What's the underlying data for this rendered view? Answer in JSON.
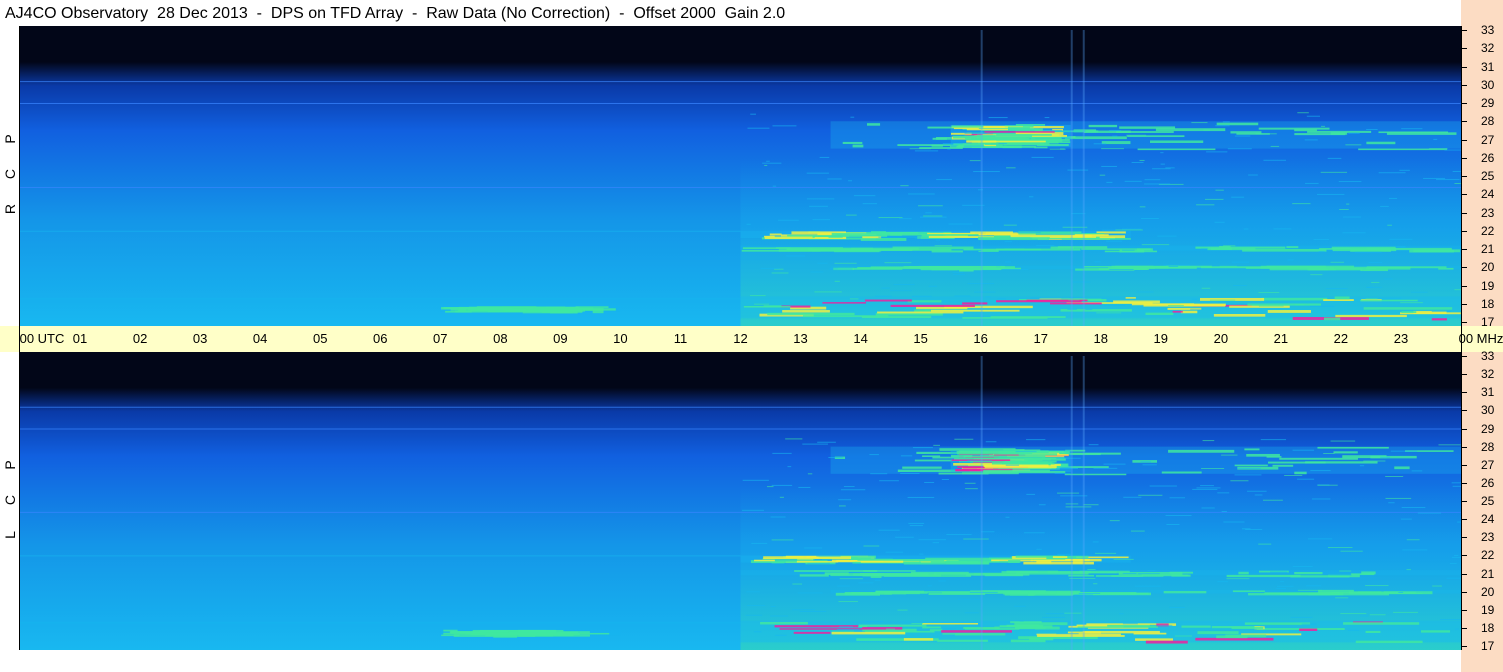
{
  "title": "AJ4CO Observatory  28 Dec 2013  -  DPS on TFD Array  -  Raw Data (No Correction)  -  Offset 2000  Gain 2.0",
  "chart_data": {
    "type": "heatmap",
    "x_unit": "UTC",
    "y_unit": "MHz",
    "x_ticks": [
      "00 UTC",
      "01",
      "02",
      "03",
      "04",
      "05",
      "06",
      "07",
      "08",
      "09",
      "10",
      "11",
      "12",
      "13",
      "14",
      "15",
      "16",
      "17",
      "18",
      "19",
      "20",
      "21",
      "22",
      "23",
      "00 MHz"
    ],
    "y_ticks": [
      "33",
      "32",
      "31",
      "30",
      "29",
      "28",
      "27",
      "26",
      "25",
      "24",
      "23",
      "22",
      "21",
      "20",
      "19",
      "18",
      "17"
    ],
    "xlim": [
      0,
      24
    ],
    "ylim": [
      17,
      33
    ],
    "panels": [
      {
        "label_letters": [
          "P",
          "C",
          "R"
        ]
      },
      {
        "label_letters": [
          "P",
          "C",
          "L"
        ]
      }
    ],
    "colors": {
      "background_dark": "#020618",
      "base_blue": "#1160e0",
      "mid_cyan": "#18b8f0",
      "green": "#40e8a0",
      "yellow": "#f0f040",
      "magenta": "#f020a0",
      "time_strip": "#ffffc8",
      "freq_strip": "#fcdcc3"
    },
    "emission_bands": [
      {
        "t_start": 12.0,
        "t_end": 24.0,
        "f_low": 17.2,
        "f_high": 18.4,
        "intensity": 1.0
      },
      {
        "t_start": 12.0,
        "t_end": 18.5,
        "f_low": 21.6,
        "f_high": 22.0,
        "intensity": 0.8
      },
      {
        "t_start": 12.0,
        "t_end": 24.0,
        "f_low": 20.9,
        "f_high": 21.2,
        "intensity": 0.6
      },
      {
        "t_start": 13.5,
        "t_end": 24.0,
        "f_low": 19.9,
        "f_high": 20.1,
        "intensity": 0.6
      },
      {
        "t_start": 13.5,
        "t_end": 24.0,
        "f_low": 26.5,
        "f_high": 28.0,
        "intensity": 0.7
      },
      {
        "t_start": 15.5,
        "t_end": 17.5,
        "f_low": 26.6,
        "f_high": 27.8,
        "intensity": 1.0
      },
      {
        "t_start": 7.0,
        "t_end": 10.0,
        "f_low": 17.6,
        "f_high": 17.9,
        "intensity": 0.5
      }
    ]
  }
}
